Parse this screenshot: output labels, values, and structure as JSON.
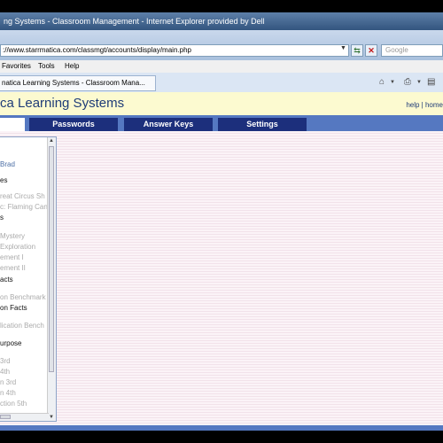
{
  "browser": {
    "title": "ng Systems - Classroom Management - Internet Explorer provided by Dell",
    "url": "://www.starrmatica.com/classmgt/accounts/display/main.php",
    "search_placeholder": "Google",
    "menu": [
      "Favorites",
      "Tools",
      "Help"
    ],
    "tab_title": "natica Learning Systems - Classroom Mana..."
  },
  "page": {
    "site_title": "ca Learning Systems",
    "links": {
      "help": "help",
      "separator": "|",
      "home": "home"
    },
    "nav": [
      {
        "label": ""
      },
      {
        "label": "Passwords"
      },
      {
        "label": "Answer Keys"
      },
      {
        "label": "Settings"
      }
    ]
  },
  "sidebar": {
    "items": [
      {
        "text": "",
        "style": "dark"
      },
      {
        "text": "Brad",
        "style": "blue"
      },
      {
        "text": "es",
        "style": "dark"
      },
      {
        "text": "reat Circus Sh",
        "style": "gray"
      },
      {
        "text": "c: Flaming Can",
        "style": "gray"
      },
      {
        "text": "s",
        "style": "dark"
      },
      {
        "text": "Mystery",
        "style": "gray"
      },
      {
        "text": "Exploration",
        "style": "gray"
      },
      {
        "text": "ement I",
        "style": "gray"
      },
      {
        "text": "ement II",
        "style": "gray"
      },
      {
        "text": "acts",
        "style": "dark"
      },
      {
        "text": "on Benchmark",
        "style": "gray"
      },
      {
        "text": "on Facts",
        "style": "dark"
      },
      {
        "text": "lication Bench",
        "style": "gray"
      },
      {
        "text": "urpose",
        "style": "dark"
      },
      {
        "text": "3rd",
        "style": "gray"
      },
      {
        "text": "4th",
        "style": "gray"
      },
      {
        "text": "n 3rd",
        "style": "gray"
      },
      {
        "text": "n 4th",
        "style": "gray"
      },
      {
        "text": "ction 5th",
        "style": "gray"
      }
    ],
    "side_marker": "E"
  },
  "colors": {
    "header_bg": "#fcfad0",
    "nav_bar": "#5578c1",
    "nav_tab": "#1c2f7c",
    "title_text": "#1f3c78"
  }
}
